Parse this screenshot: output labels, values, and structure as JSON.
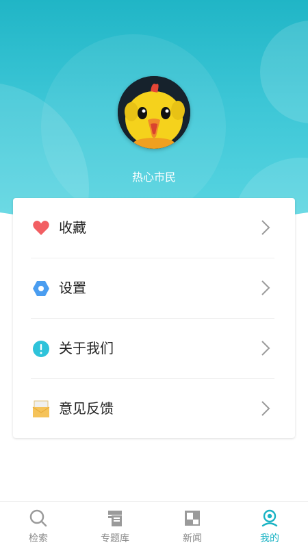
{
  "profile": {
    "username": "热心市民",
    "avatar_icon": "chick-mascot-avatar"
  },
  "menu": {
    "items": [
      {
        "label": "收藏",
        "icon": "heart-icon",
        "color": "#f25f63"
      },
      {
        "label": "设置",
        "icon": "hexagon-settings-icon",
        "color": "#4a9df0"
      },
      {
        "label": "关于我们",
        "icon": "info-icon",
        "color": "#2ec3da"
      },
      {
        "label": "意见反馈",
        "icon": "envelope-icon",
        "color": "#f5c35a"
      }
    ]
  },
  "tabbar": {
    "tabs": [
      {
        "label": "检索",
        "icon": "search-icon",
        "active": false
      },
      {
        "label": "专题库",
        "icon": "library-icon",
        "active": false
      },
      {
        "label": "新闻",
        "icon": "news-icon",
        "active": false
      },
      {
        "label": "我的",
        "icon": "profile-icon",
        "active": true
      }
    ]
  },
  "colors": {
    "accent": "#1ab3c4",
    "header_top": "#20b5c6",
    "header_bottom": "#5bd6e2",
    "inactive_tab": "#8a8a8a"
  }
}
